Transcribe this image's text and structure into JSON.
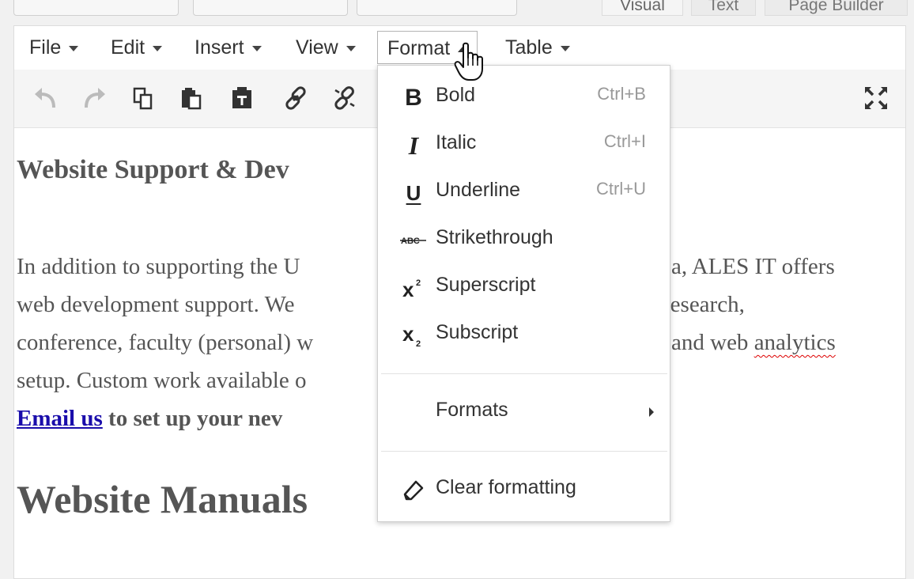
{
  "mode_tabs": [
    "Visual",
    "Text",
    "Page Builder"
  ],
  "menubar": {
    "items": [
      {
        "label": "File"
      },
      {
        "label": "Edit"
      },
      {
        "label": "Insert"
      },
      {
        "label": "View"
      },
      {
        "label": "Format",
        "open": true
      },
      {
        "label": "Table"
      }
    ]
  },
  "toolbar": {
    "icons": [
      "undo-icon",
      "redo-icon",
      "copy-icon",
      "paste-icon",
      "paste-text-icon",
      "link-icon",
      "unlink-icon",
      "fullscreen-icon"
    ]
  },
  "content": {
    "heading_support": "Website Support & Dev",
    "para_left": [
      "In addition to supporting the U",
      "web development support. We",
      "conference, faculty (personal) w",
      "setup. Custom work available o"
    ],
    "para_right": [
      "a, ALES IT offers",
      "research,",
      "and web ",
      ""
    ],
    "para_right_spell": "analytics",
    "email_link": "Email us",
    "email_rest": " to set up your nev",
    "heading_manuals": "Website Manuals"
  },
  "format_menu": {
    "items": [
      {
        "label": "Bold",
        "shortcut": "Ctrl+B",
        "icon": "bold-icon"
      },
      {
        "label": "Italic",
        "shortcut": "Ctrl+I",
        "icon": "italic-icon"
      },
      {
        "label": "Underline",
        "shortcut": "Ctrl+U",
        "icon": "underline-icon"
      },
      {
        "label": "Strikethrough",
        "shortcut": "",
        "icon": "strikethrough-icon"
      },
      {
        "label": "Superscript",
        "shortcut": "",
        "icon": "superscript-icon"
      },
      {
        "label": "Subscript",
        "shortcut": "",
        "icon": "subscript-icon"
      }
    ],
    "formats_label": "Formats",
    "clear_label": "Clear formatting"
  }
}
